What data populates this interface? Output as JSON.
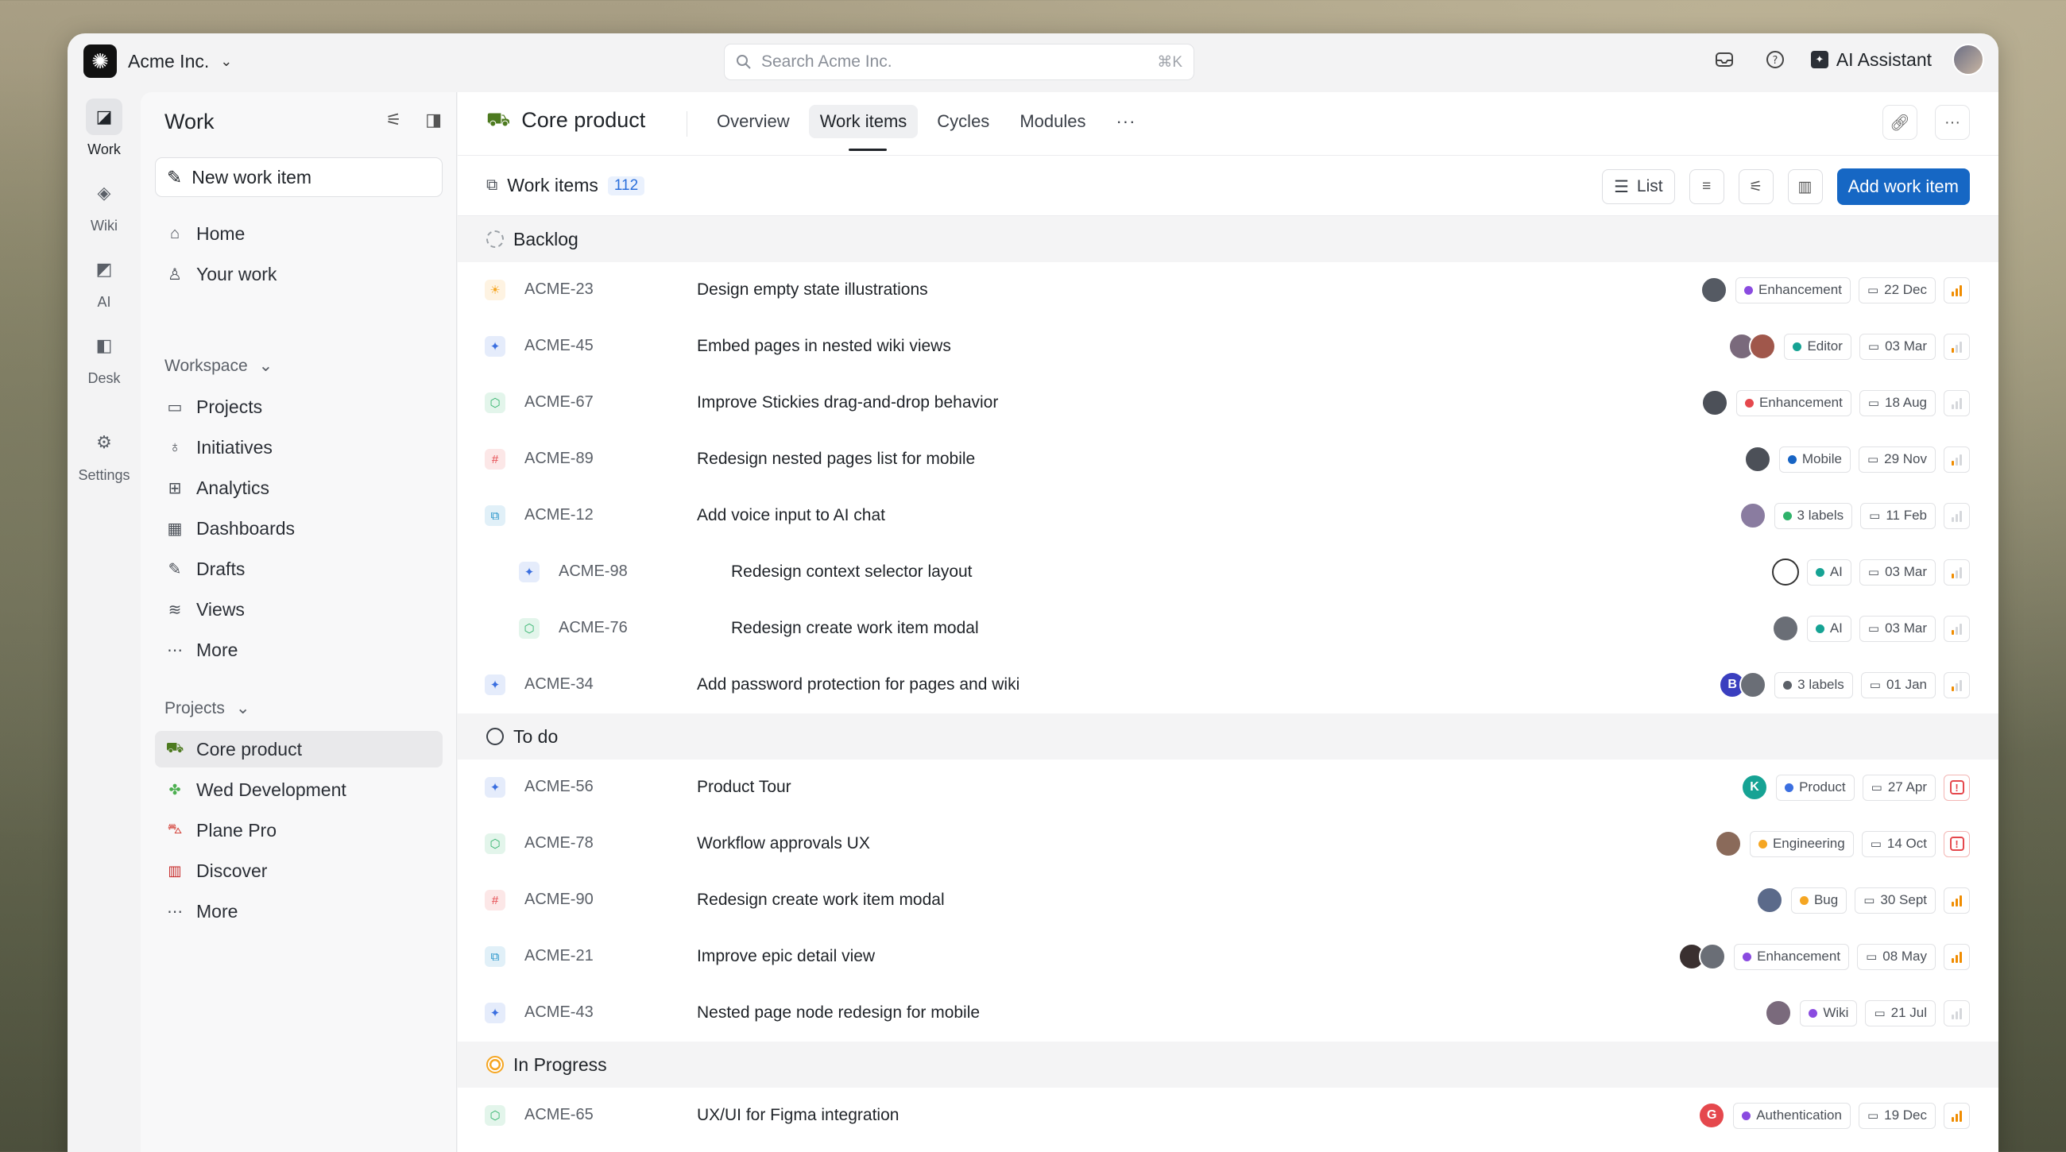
{
  "workspace": {
    "name": "Acme Inc."
  },
  "search": {
    "placeholder": "Search Acme Inc.",
    "shortcut": "⌘K"
  },
  "topbar": {
    "ai_label": "AI Assistant"
  },
  "rail": [
    {
      "label": "Work",
      "icon": "work-icon",
      "active": true
    },
    {
      "label": "Wiki",
      "icon": "wiki-icon"
    },
    {
      "label": "AI",
      "icon": "ai-icon"
    },
    {
      "label": "Desk",
      "icon": "desk-icon"
    },
    {
      "label": "Settings",
      "icon": "settings-icon"
    }
  ],
  "sidebar": {
    "title": "Work",
    "new_item": "New work item",
    "nav": [
      {
        "label": "Home",
        "icon": "home-icon"
      },
      {
        "label": "Your work",
        "icon": "user-icon"
      }
    ],
    "workspace_label": "Workspace",
    "workspace_items": [
      {
        "label": "Projects",
        "icon": "briefcase-icon"
      },
      {
        "label": "Initiatives",
        "icon": "lightbulb-icon"
      },
      {
        "label": "Analytics",
        "icon": "analytics-icon"
      },
      {
        "label": "Dashboards",
        "icon": "dashboard-icon"
      },
      {
        "label": "Drafts",
        "icon": "pen-icon"
      },
      {
        "label": "Views",
        "icon": "layers-icon"
      },
      {
        "label": "More",
        "icon": "more-icon"
      }
    ],
    "projects_label": "Projects",
    "projects": [
      {
        "label": "Core product",
        "icon": "tractor-icon",
        "active": true
      },
      {
        "label": "Wed Development",
        "icon": "puzzle-icon"
      },
      {
        "label": "Plane Pro",
        "icon": "car-icon"
      },
      {
        "label": "Discover",
        "icon": "red-building-icon"
      },
      {
        "label": "More",
        "icon": "more-icon"
      }
    ]
  },
  "project": {
    "title": "Core product",
    "tabs": [
      "Overview",
      "Work items",
      "Cycles",
      "Modules"
    ],
    "active_tab": "Work items"
  },
  "workitems": {
    "title": "Work items",
    "count": "112",
    "layout_label": "List",
    "add_label": "Add work item"
  },
  "groups": [
    {
      "name": "Backlog",
      "color": "#9aa0a6",
      "items": [
        {
          "id": "ACME-23",
          "title": "Design empty state illustrations",
          "type_color": "#f5a623",
          "type_glyph": "☀",
          "avatars": [
            {
              "bg": "#555a63",
              "t": ""
            }
          ],
          "label": "Enhancement",
          "label_color": "#8a4be0",
          "date": "22 Dec",
          "priority": "high"
        },
        {
          "id": "ACME-45",
          "title": "Embed pages in nested wiki views",
          "type_color": "#3b6fe0",
          "type_glyph": "✦",
          "avatars": [
            {
              "bg": "#7a6a7c",
              "t": ""
            },
            {
              "bg": "#a0574b",
              "t": ""
            }
          ],
          "label": "Editor",
          "label_color": "#16a394",
          "date": "03 Mar",
          "priority": "low"
        },
        {
          "id": "ACME-67",
          "title": "Improve Stickies drag-and-drop behavior",
          "type_color": "#2fb26a",
          "type_glyph": "⬡",
          "avatars": [
            {
              "bg": "#4c5058",
              "t": ""
            }
          ],
          "label": "Enhancement",
          "label_color": "#e5484d",
          "date": "18 Aug",
          "priority": "none"
        },
        {
          "id": "ACME-89",
          "title": "Redesign nested pages list for mobile",
          "type_color": "#e5484d",
          "type_glyph": "#",
          "avatars": [
            {
              "bg": "#4c5058",
              "t": ""
            }
          ],
          "label": "Mobile",
          "label_color": "#1764c4",
          "date": "29 Nov",
          "priority": "low"
        },
        {
          "id": "ACME-12",
          "title": "Add voice input to AI chat",
          "type_color": "#1e90c8",
          "type_glyph": "⧉",
          "avatars": [
            {
              "bg": "#8a7ca0",
              "t": ""
            }
          ],
          "label": "3 labels",
          "label_color": "#2fb26a",
          "date": "11 Feb",
          "priority": "none"
        },
        {
          "id": "ACME-98",
          "title": "Redesign context selector layout",
          "type_color": "#3b6fe0",
          "type_glyph": "✦",
          "indent": true,
          "avatars": [
            {
              "bg": "#ffffff",
              "t": ""
            }
          ],
          "label": "AI",
          "label_color": "#16a394",
          "date": "03 Mar",
          "priority": "low"
        },
        {
          "id": "ACME-76",
          "title": "Redesign create work item modal",
          "type_color": "#2fb26a",
          "type_glyph": "⬡",
          "indent": true,
          "avatars": [
            {
              "bg": "#6a6e76",
              "t": ""
            }
          ],
          "label": "AI",
          "label_color": "#16a394",
          "date": "03 Mar",
          "priority": "low"
        },
        {
          "id": "ACME-34",
          "title": "Add password protection for pages and wiki",
          "type_color": "#3b6fe0",
          "type_glyph": "✦",
          "avatars": [
            {
              "bg": "#3a3fbf",
              "t": "B"
            },
            {
              "bg": "#6a6e76",
              "t": ""
            }
          ],
          "label": "3 labels",
          "label_color": "#5b6068",
          "date": "01 Jan",
          "priority": "low"
        }
      ]
    },
    {
      "name": "To do",
      "color": "#3b4048",
      "items": [
        {
          "id": "ACME-56",
          "title": "Product Tour",
          "type_color": "#3b6fe0",
          "type_glyph": "✦",
          "avatars": [
            {
              "bg": "#16a394",
              "t": "K"
            }
          ],
          "label": "Product",
          "label_color": "#3b6fe0",
          "date": "27 Apr",
          "priority": "urgent"
        },
        {
          "id": "ACME-78",
          "title": "Workflow approvals UX",
          "type_color": "#2fb26a",
          "type_glyph": "⬡",
          "avatars": [
            {
              "bg": "#8a6a5a",
              "t": ""
            }
          ],
          "label": "Engineering",
          "label_color": "#f5a623",
          "date": "14 Oct",
          "priority": "urgent"
        },
        {
          "id": "ACME-90",
          "title": "Redesign create work item modal",
          "type_color": "#e5484d",
          "type_glyph": "#",
          "avatars": [
            {
              "bg": "#5b6a8a",
              "t": ""
            }
          ],
          "label": "Bug",
          "label_color": "#f5a623",
          "date": "30 Sept",
          "priority": "high"
        },
        {
          "id": "ACME-21",
          "title": "Improve epic detail view",
          "type_color": "#1e90c8",
          "type_glyph": "⧉",
          "avatars": [
            {
              "bg": "#3a3030",
              "t": ""
            },
            {
              "bg": "#6a6e76",
              "t": ""
            }
          ],
          "label": "Enhancement",
          "label_color": "#8a4be0",
          "date": "08 May",
          "priority": "high"
        },
        {
          "id": "ACME-43",
          "title": "Nested page node redesign for mobile",
          "type_color": "#3b6fe0",
          "type_glyph": "✦",
          "avatars": [
            {
              "bg": "#7a6a7c",
              "t": ""
            }
          ],
          "label": "Wiki",
          "label_color": "#8a4be0",
          "date": "21 Jul",
          "priority": "none"
        }
      ]
    },
    {
      "name": "In Progress",
      "color": "#f5a623",
      "items": [
        {
          "id": "ACME-65",
          "title": "UX/UI for Figma integration",
          "type_color": "#2fb26a",
          "type_glyph": "⬡",
          "avatars": [
            {
              "bg": "#e5484d",
              "t": "G"
            }
          ],
          "label": "Authentication",
          "label_color": "#8a4be0",
          "date": "19 Dec",
          "priority": "high"
        }
      ]
    }
  ]
}
